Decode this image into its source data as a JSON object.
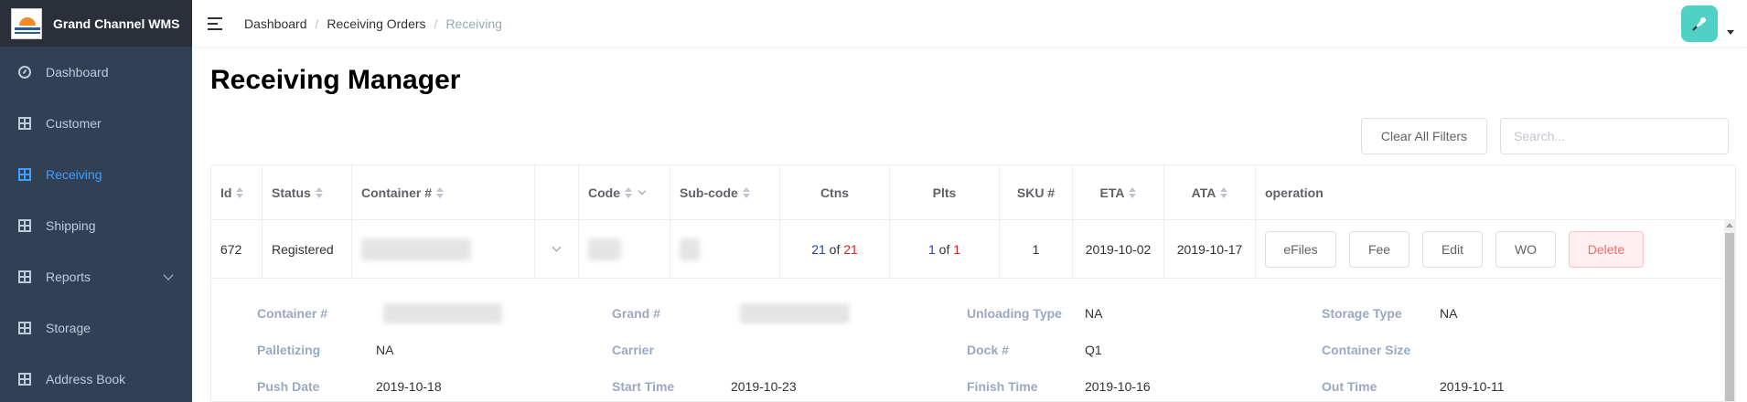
{
  "app": {
    "brand": "Grand Channel WMS"
  },
  "sidebar": {
    "items": [
      {
        "label": "Dashboard",
        "icon": "dashboard-icon"
      },
      {
        "label": "Customer",
        "icon": "grid-icon"
      },
      {
        "label": "Receiving",
        "icon": "grid-icon",
        "active": true
      },
      {
        "label": "Shipping",
        "icon": "grid-icon"
      },
      {
        "label": "Reports",
        "icon": "grid-icon",
        "expandable": true
      },
      {
        "label": "Storage",
        "icon": "grid-icon"
      },
      {
        "label": "Address Book",
        "icon": "grid-icon"
      }
    ]
  },
  "breadcrumb": [
    "Dashboard",
    "Receiving Orders",
    "Receiving"
  ],
  "page": {
    "title": "Receiving Manager"
  },
  "toolbar": {
    "clear_filters": "Clear All Filters",
    "search_placeholder": "Search..."
  },
  "table": {
    "columns": [
      "Id",
      "Status",
      "Container #",
      "",
      "Code",
      "Sub-code",
      "Ctns",
      "Plts",
      "SKU #",
      "ETA",
      "ATA",
      "operation"
    ],
    "row": {
      "id": "672",
      "status": "Registered",
      "ctns_a": "21",
      "ctns_of": "of",
      "ctns_b": "21",
      "plts_a": "1",
      "plts_of": "of",
      "plts_b": "1",
      "sku": "1",
      "eta": "2019-10-02",
      "ata": "2019-10-17",
      "operations": [
        "eFiles",
        "Fee",
        "Edit",
        "WO",
        "Delete"
      ]
    }
  },
  "details": {
    "container_label": "Container #",
    "grand_label": "Grand #",
    "unloading_type_label": "Unloading Type",
    "unloading_type_value": "NA",
    "storage_type_label": "Storage Type",
    "storage_type_value": "NA",
    "palletizing_label": "Palletizing",
    "palletizing_value": "NA",
    "carrier_label": "Carrier",
    "dock_label": "Dock #",
    "dock_value": "Q1",
    "container_size_label": "Container Size",
    "push_date_label": "Push Date",
    "push_date_value": "2019-10-18",
    "start_time_label": "Start Time",
    "start_time_value": "2019-10-23",
    "finish_time_label": "Finish Time",
    "finish_time_value": "2019-10-16",
    "out_time_label": "Out Time",
    "out_time_value": "2019-10-11"
  },
  "colors": {
    "sidebar_bg": "#304156",
    "brand_bg": "#2b2f3a",
    "active": "#409eff",
    "avatar": "#4fd1c5",
    "danger": "#f56c6c"
  }
}
